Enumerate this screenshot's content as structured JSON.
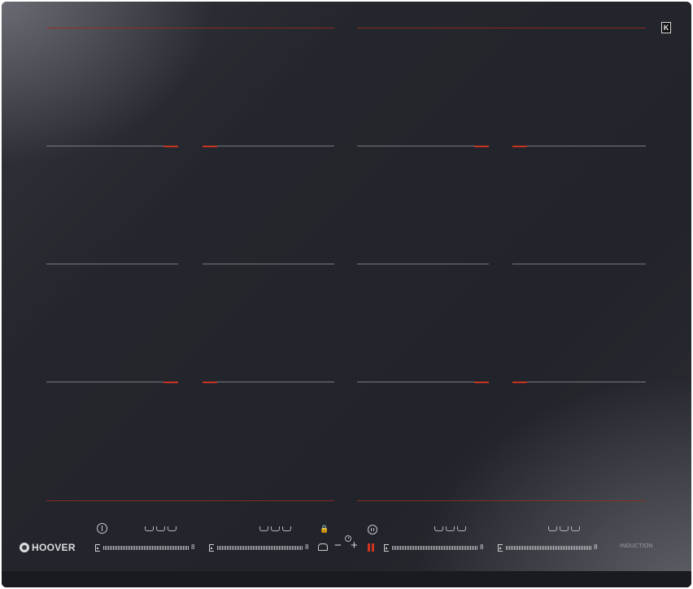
{
  "brand": {
    "name": "HOOVER",
    "technology": "INDUCTION",
    "badge": "K"
  },
  "controls": {
    "minus": "−",
    "plus": "+",
    "slider_max": "8",
    "zones": [
      {
        "id": "zone-1"
      },
      {
        "id": "zone-2"
      },
      {
        "id": "zone-3"
      },
      {
        "id": "zone-4"
      }
    ]
  },
  "icons": [
    "power-icon",
    "lock-icon",
    "timer-icon",
    "pause-icon",
    "chef-hat-icon",
    "cooking-mode-icon"
  ],
  "colors": {
    "glass": "#24262d",
    "accent_red": "#c8341f",
    "print": "#cfd0d3"
  }
}
